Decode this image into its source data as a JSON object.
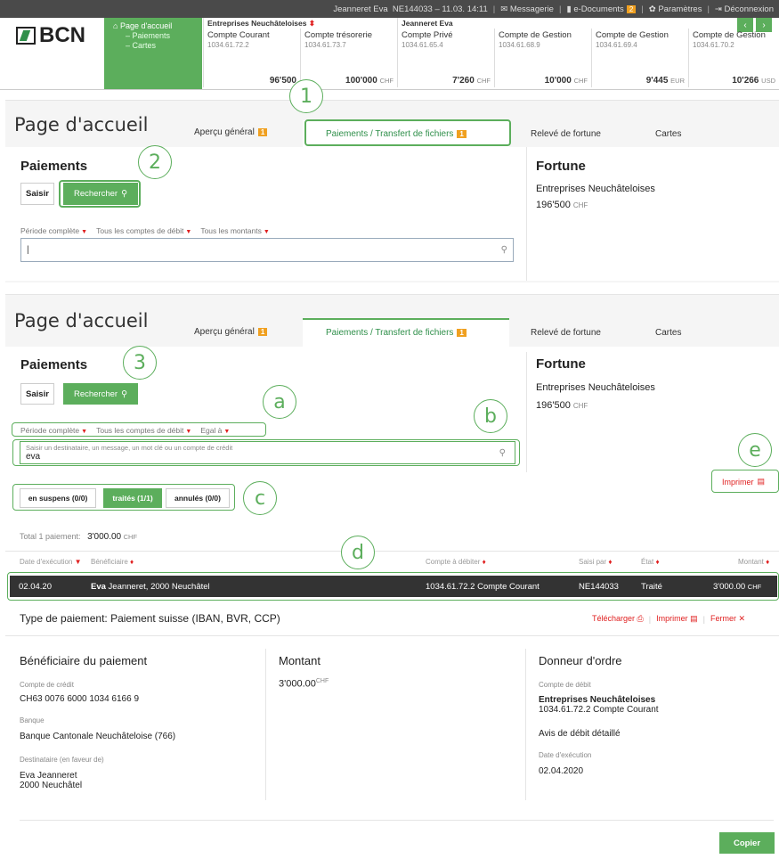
{
  "topbar": {
    "user": "Jeanneret Eva",
    "id_time": "NE144033 – 11.03. 14:11",
    "messagerie": "Messagerie",
    "edocs": "e-Documents",
    "edocs_count": "2",
    "parametres": "Paramètres",
    "deconnexion": "Déconnexion"
  },
  "header": {
    "logo": "BCN",
    "nav": {
      "home": "Page d'accueil",
      "paiements": "– Paiements",
      "cartes": "– Cartes"
    },
    "group1": "Entreprises Neuchâteloises",
    "group2": "Jeanneret Eva",
    "accounts": [
      {
        "name": "Compte Courant",
        "num": "1034.61.72.2",
        "amount": "96'500",
        "cur": ""
      },
      {
        "name": "Compte trésorerie",
        "num": "1034.61.73.7",
        "amount": "100'000",
        "cur": "CHF"
      },
      {
        "name": "Compte Privé",
        "num": "1034.61.65.4",
        "amount": "7'260",
        "cur": "CHF"
      },
      {
        "name": "Compte de Gestion",
        "num": "1034.61.68.9",
        "amount": "10'000",
        "cur": "CHF"
      },
      {
        "name": "Compte de Gestion",
        "num": "1034.61.69.4",
        "amount": "9'445",
        "cur": "EUR"
      },
      {
        "name": "Compte de Gestion",
        "num": "1034.61.70.2",
        "amount": "10'266",
        "cur": "USD"
      }
    ]
  },
  "p1": {
    "title": "Page d'accueil",
    "tabs": [
      {
        "label": "Aperçu général",
        "badge": "1"
      },
      {
        "label": "Paiements / Transfert de fichiers",
        "badge": "1"
      },
      {
        "label": "Relevé de fortune"
      },
      {
        "label": "Cartes"
      }
    ],
    "paiements": "Paiements",
    "saisir": "Saisir",
    "rechercher": "Rechercher",
    "filters": [
      "Période complète",
      "Tous les comptes de débit",
      "Tous les montants"
    ],
    "search_value": "|",
    "fortune": "Fortune",
    "entreprise": "Entreprises Neuchâteloises",
    "amount": "196'500",
    "cur": "CHF"
  },
  "p2": {
    "title": "Page d'accueil",
    "tabs": [
      {
        "label": "Aperçu général",
        "badge": "1"
      },
      {
        "label": "Paiements / Transfert de fichiers",
        "badge": "1"
      },
      {
        "label": "Relevé de fortune"
      },
      {
        "label": "Cartes"
      }
    ],
    "paiements": "Paiements",
    "saisir": "Saisir",
    "rechercher": "Rechercher",
    "filters": [
      "Période complète",
      "Tous les comptes de débit",
      "Egal à"
    ],
    "search_hint": "Saisir un destinataire, un message, un mot clé ou un compte de crédit",
    "search_value": "eva",
    "fortune": "Fortune",
    "entreprise": "Entreprises Neuchâteloises",
    "amount": "196'500",
    "cur": "CHF",
    "segments": [
      "en suspens (0/0)",
      "traités (1/1)",
      "annulés (0/0)"
    ],
    "imprimer": "Imprimer",
    "total_label": "Total 1 paiement:",
    "total_value": "3'000.00",
    "total_cur": "CHF",
    "columns": [
      "Date d'exécution",
      "Bénéficiaire",
      "Compte à débiter",
      "Saisi par",
      "État",
      "Montant"
    ],
    "row": {
      "date": "02.04.20",
      "benef_bold": "Eva",
      "benef": "Jeanneret, 2000 Neuchâtel",
      "compte": "1034.61.72.2 Compte Courant",
      "saisi": "NE144033",
      "etat": "Traité",
      "montant": "3'000.00",
      "cur": "CHF"
    }
  },
  "detail": {
    "type": "Type de paiement: Paiement suisse (IBAN, BVR, CCP)",
    "telecharger": "Télécharger",
    "imprimer": "Imprimer",
    "fermer": "Fermer",
    "benef_title": "Bénéficiaire du paiement",
    "compte_credit_lbl": "Compte de crédit",
    "compte_credit": "CH63 0076 6000 1034 6166 9",
    "banque_lbl": "Banque",
    "banque": "Banque Cantonale Neuchâteloise (766)",
    "dest_lbl": "Destinataire (en faveur de)",
    "dest1": "Eva Jeanneret",
    "dest2": "2000 Neuchâtel",
    "montant_title": "Montant",
    "montant": "3'000.00",
    "montant_cur": "CHF",
    "donneur_title": "Donneur d'ordre",
    "compte_debit_lbl": "Compte de débit",
    "compte_debit1": "Entreprises Neuchâteloises",
    "compte_debit2": "1034.61.72.2 Compte Courant",
    "avis": "Avis de débit détaillé",
    "date_lbl": "Date d'exécution",
    "date": "02.04.2020",
    "copier": "Copier"
  },
  "callouts": {
    "c1": "1",
    "c2": "2",
    "c3": "3",
    "ca": "a",
    "cb": "b",
    "cc": "c",
    "cd": "d",
    "ce": "e"
  },
  "colors": {
    "green": "#5cae5c",
    "orange": "#f0a020",
    "red": "#e02020",
    "dark": "#333333"
  }
}
